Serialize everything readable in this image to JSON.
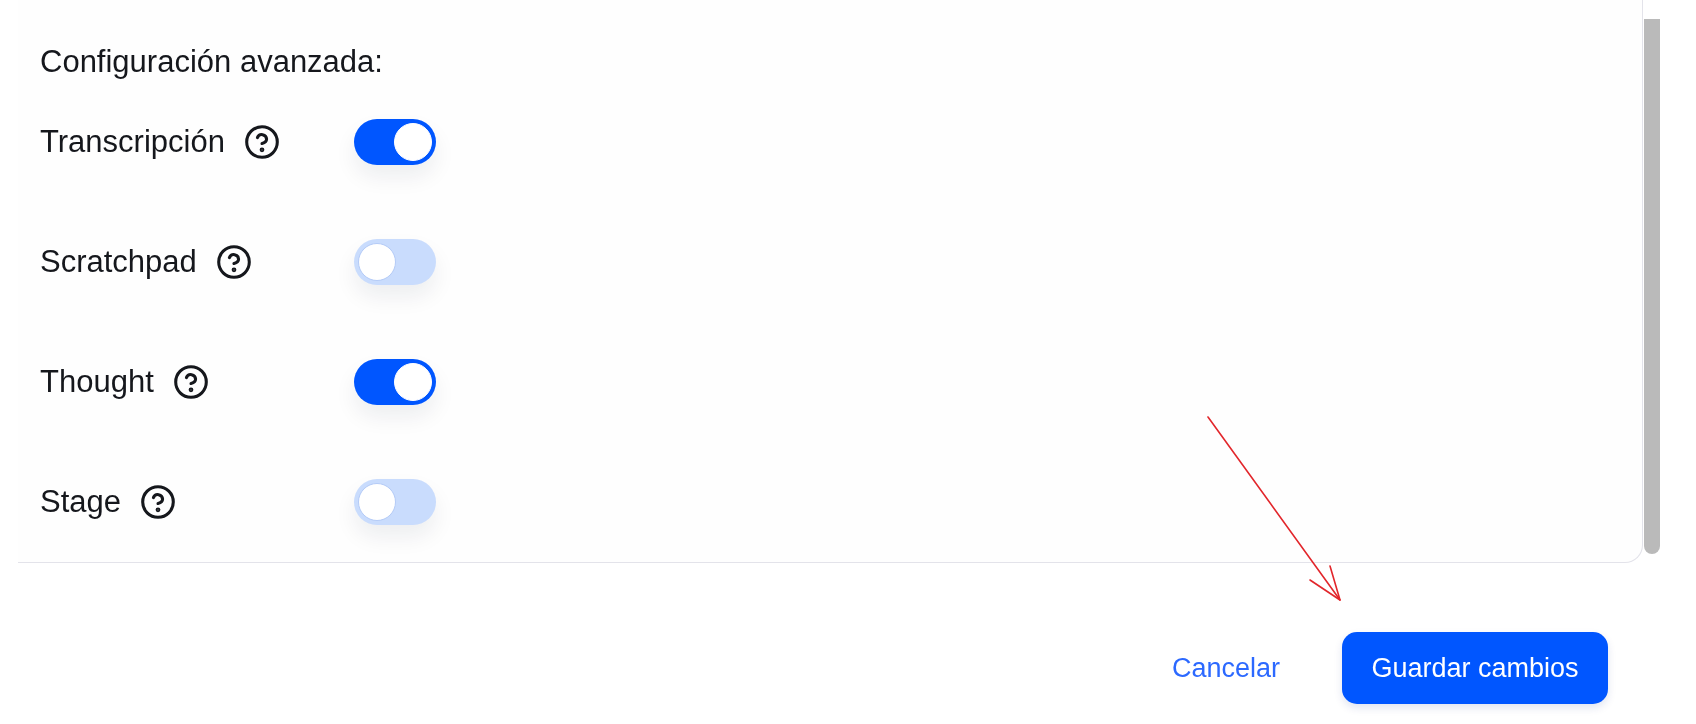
{
  "section": {
    "title": "Configuración avanzada:"
  },
  "settings": [
    {
      "label": "Transcripción",
      "on": true
    },
    {
      "label": "Scratchpad",
      "on": false
    },
    {
      "label": "Thought",
      "on": true
    },
    {
      "label": "Stage",
      "on": false
    }
  ],
  "footer": {
    "buttons": [
      {
        "kind": "link",
        "label": "Cancelar"
      },
      {
        "kind": "primary",
        "label": "Guardar cambios"
      }
    ]
  }
}
